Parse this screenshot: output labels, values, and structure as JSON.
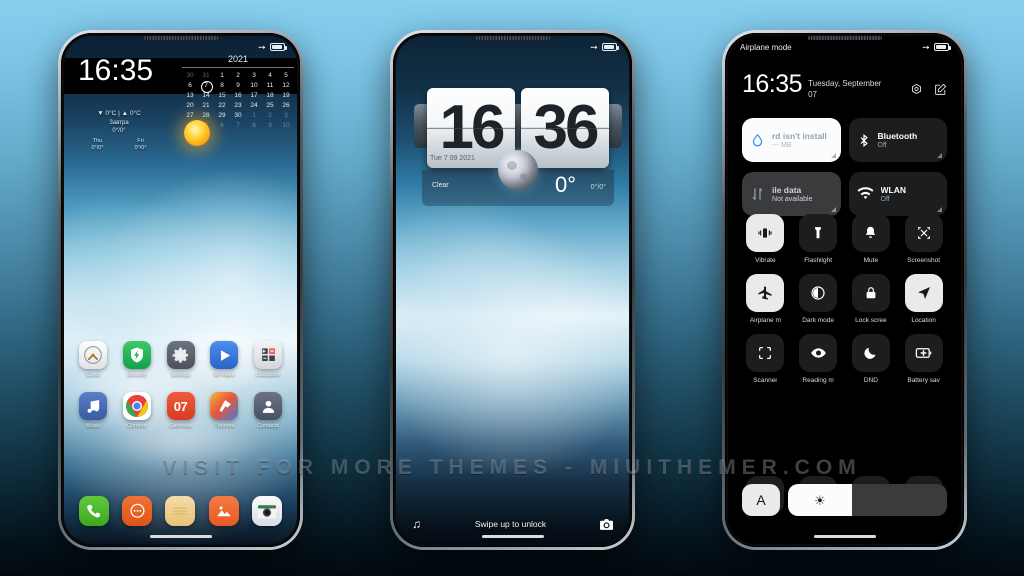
{
  "watermark": "VISIT  FOR  MORE  THEMES  -  MIUITHEMER.COM",
  "colors": {
    "background_top": "#86cfee",
    "background_bottom": "#020a10",
    "accent_blue": "#2e90f5",
    "tile_on": "#fbfcfd",
    "tile_off": "#1c1d1f"
  },
  "phone1": {
    "name": "home-screen",
    "statusbar": {
      "left": "",
      "airplane_icon": "airplane-icon",
      "battery_icon": "battery-icon"
    },
    "clock": "16:35",
    "calendar": {
      "year": "2021",
      "days": [
        {
          "d": "30",
          "state": "dim"
        },
        {
          "d": "31",
          "state": "dim"
        },
        {
          "d": "1",
          "state": ""
        },
        {
          "d": "2",
          "state": ""
        },
        {
          "d": "3",
          "state": ""
        },
        {
          "d": "4",
          "state": ""
        },
        {
          "d": "5",
          "state": ""
        },
        {
          "d": "6",
          "state": ""
        },
        {
          "d": "7",
          "state": "today"
        },
        {
          "d": "8",
          "state": ""
        },
        {
          "d": "9",
          "state": ""
        },
        {
          "d": "10",
          "state": ""
        },
        {
          "d": "11",
          "state": ""
        },
        {
          "d": "12",
          "state": ""
        },
        {
          "d": "13",
          "state": ""
        },
        {
          "d": "14",
          "state": ""
        },
        {
          "d": "15",
          "state": ""
        },
        {
          "d": "16",
          "state": ""
        },
        {
          "d": "17",
          "state": ""
        },
        {
          "d": "18",
          "state": ""
        },
        {
          "d": "19",
          "state": ""
        },
        {
          "d": "20",
          "state": ""
        },
        {
          "d": "21",
          "state": ""
        },
        {
          "d": "22",
          "state": ""
        },
        {
          "d": "23",
          "state": ""
        },
        {
          "d": "24",
          "state": ""
        },
        {
          "d": "25",
          "state": ""
        },
        {
          "d": "26",
          "state": ""
        },
        {
          "d": "27",
          "state": ""
        },
        {
          "d": "28",
          "state": ""
        },
        {
          "d": "29",
          "state": ""
        },
        {
          "d": "30",
          "state": ""
        },
        {
          "d": "1",
          "state": "dim"
        },
        {
          "d": "2",
          "state": "dim"
        },
        {
          "d": "3",
          "state": "dim"
        },
        {
          "d": "4",
          "state": "dim"
        },
        {
          "d": "5",
          "state": "dim"
        },
        {
          "d": "6",
          "state": "dim"
        },
        {
          "d": "7",
          "state": "dim"
        },
        {
          "d": "8",
          "state": "dim"
        },
        {
          "d": "9",
          "state": "dim"
        },
        {
          "d": "10",
          "state": "dim"
        }
      ]
    },
    "weather": {
      "range": "▼ 0°C | ▲ 0°C",
      "tomorrow_label": "Завтра",
      "tomorrow_temp": "0°/0°",
      "days": [
        {
          "name": "Thu",
          "temp": "0°/0°"
        },
        {
          "name": "Fri",
          "temp": "0°/0°"
        }
      ],
      "icon": "sun-icon"
    },
    "apps_row1": [
      {
        "label": "Clock",
        "icon": "clock-icon"
      },
      {
        "label": "Security",
        "icon": "shield-icon"
      },
      {
        "label": "Settings",
        "icon": "gear-icon"
      },
      {
        "label": "Mi Video",
        "icon": "play-icon"
      },
      {
        "label": "Calculator",
        "icon": "calculator-icon"
      }
    ],
    "apps_row2": [
      {
        "label": "Music",
        "icon": "music-note-icon"
      },
      {
        "label": "Chrome",
        "icon": "chrome-icon"
      },
      {
        "label": "Calendar",
        "icon": "calendar-icon",
        "badge": "07"
      },
      {
        "label": "Themes",
        "icon": "themes-icon"
      },
      {
        "label": "Contacts",
        "icon": "person-icon"
      }
    ],
    "dock": [
      {
        "label": "Phone",
        "icon": "phone-icon"
      },
      {
        "label": "Messages",
        "icon": "message-icon"
      },
      {
        "label": "Notes",
        "icon": "notes-icon"
      },
      {
        "label": "Gallery",
        "icon": "gallery-icon"
      },
      {
        "label": "Camera",
        "icon": "camera-icon"
      }
    ]
  },
  "phone2": {
    "name": "lock-screen",
    "statusbar": {
      "airplane_icon": "airplane-icon",
      "battery_icon": "battery-icon"
    },
    "flip_clock": {
      "hours": "16",
      "minutes": "36",
      "date": "Tue 7 09 2021",
      "condition": "Clear",
      "temperature": "0°",
      "high_low": "0°/0°",
      "moon_icon": "moon-icon"
    },
    "bottom": {
      "music_icon": "music-note-icon",
      "hint": "Swipe up to unlock",
      "camera_icon": "camera-icon"
    }
  },
  "phone3": {
    "name": "control-center",
    "statusbar": {
      "left": "Airplane mode",
      "airplane_icon": "airplane-icon",
      "battery_icon": "battery-icon"
    },
    "time": "16:35",
    "date": "Tuesday, September 07",
    "header_icons": [
      {
        "name": "settings-gear-icon"
      },
      {
        "name": "edit-icon"
      }
    ],
    "big_tiles": [
      {
        "title": "rd isn't install",
        "subtitle": "--- MB",
        "state": "on",
        "icon": "water-drop-icon"
      },
      {
        "title": "Bluetooth",
        "subtitle": "Off",
        "state": "off",
        "icon": "bluetooth-icon"
      },
      {
        "title": "ile data",
        "subtitle": "Not available",
        "state": "dim",
        "icon": "mobile-data-icon"
      },
      {
        "title": "WLAN",
        "subtitle": "Off",
        "state": "off",
        "icon": "wifi-icon"
      }
    ],
    "quick_settings": [
      {
        "label": "Vibrate",
        "icon": "vibrate-icon",
        "active": true
      },
      {
        "label": "Flashlight",
        "icon": "flashlight-icon",
        "active": false
      },
      {
        "label": "Mute",
        "icon": "bell-icon",
        "active": false
      },
      {
        "label": "Screenshot",
        "icon": "screenshot-icon",
        "active": false
      },
      {
        "label": "Airplane m",
        "icon": "airplane-icon",
        "active": true
      },
      {
        "label": "Dark mode",
        "icon": "dark-mode-icon",
        "active": false
      },
      {
        "label": "Lock scree",
        "icon": "lock-icon",
        "active": false
      },
      {
        "label": "Location",
        "icon": "location-icon",
        "active": true
      },
      {
        "label": "Scanner",
        "icon": "scanner-icon",
        "active": false
      },
      {
        "label": "Reading m",
        "icon": "eye-icon",
        "active": false
      },
      {
        "label": "DND",
        "icon": "moon-icon",
        "active": false
      },
      {
        "label": "Battery sav",
        "icon": "battery-saver-icon",
        "active": false
      }
    ],
    "quick_settings_row4": [
      {
        "label": "",
        "icon": "lightning-icon",
        "active": false
      },
      {
        "label": "",
        "icon": "cast-icon",
        "active": false
      },
      {
        "label": "",
        "icon": "sync-icon",
        "active": false
      },
      {
        "label": "",
        "icon": "rotate-icon",
        "active": false
      }
    ],
    "brightness": {
      "auto_label": "A",
      "auto_icon": "auto-brightness-icon",
      "slider_icon": "brightness-icon",
      "value_percent": 40
    }
  }
}
